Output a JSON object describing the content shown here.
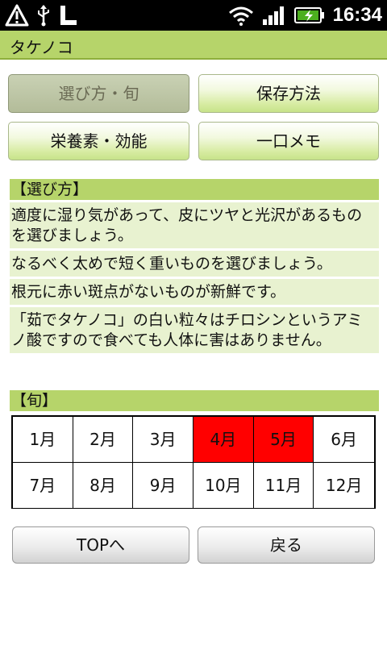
{
  "status_bar": {
    "time": "16:34",
    "left_icons": [
      "alert-icon",
      "usb-icon",
      "signal-l-icon"
    ],
    "right_icons": [
      "wifi-icon",
      "cell-signal-icon",
      "battery-charging-icon"
    ]
  },
  "app": {
    "title": "タケノコ"
  },
  "tabs": [
    {
      "label": "選び方・旬",
      "active": true
    },
    {
      "label": "保存方法",
      "active": false
    },
    {
      "label": "栄養素・効能",
      "active": false
    },
    {
      "label": "一口メモ",
      "active": false
    }
  ],
  "selection": {
    "header": "【選び方】",
    "tips": [
      "適度に湿り気があって、皮にツヤと光沢があるものを選びましょう。",
      "なるべく太めで短く重いものを選びましょう。",
      "根元に赤い斑点がないものが新鮮です。",
      "「茹でタケノコ」の白い粒々はチロシンというアミノ酸ですので食べても人体に害はありません。"
    ]
  },
  "season": {
    "header": "【旬】",
    "highlight_color": "#ff0000",
    "months": [
      {
        "label": "1月",
        "in_season": false
      },
      {
        "label": "2月",
        "in_season": false
      },
      {
        "label": "3月",
        "in_season": false
      },
      {
        "label": "4月",
        "in_season": true
      },
      {
        "label": "5月",
        "in_season": true
      },
      {
        "label": "6月",
        "in_season": false
      },
      {
        "label": "7月",
        "in_season": false
      },
      {
        "label": "8月",
        "in_season": false
      },
      {
        "label": "9月",
        "in_season": false
      },
      {
        "label": "10月",
        "in_season": false
      },
      {
        "label": "11月",
        "in_season": false
      },
      {
        "label": "12月",
        "in_season": false
      }
    ]
  },
  "nav": {
    "top_label": "TOPへ",
    "back_label": "戻る"
  },
  "colors": {
    "accent": "#b6d46a",
    "tip_background": "#e8f2d0"
  }
}
